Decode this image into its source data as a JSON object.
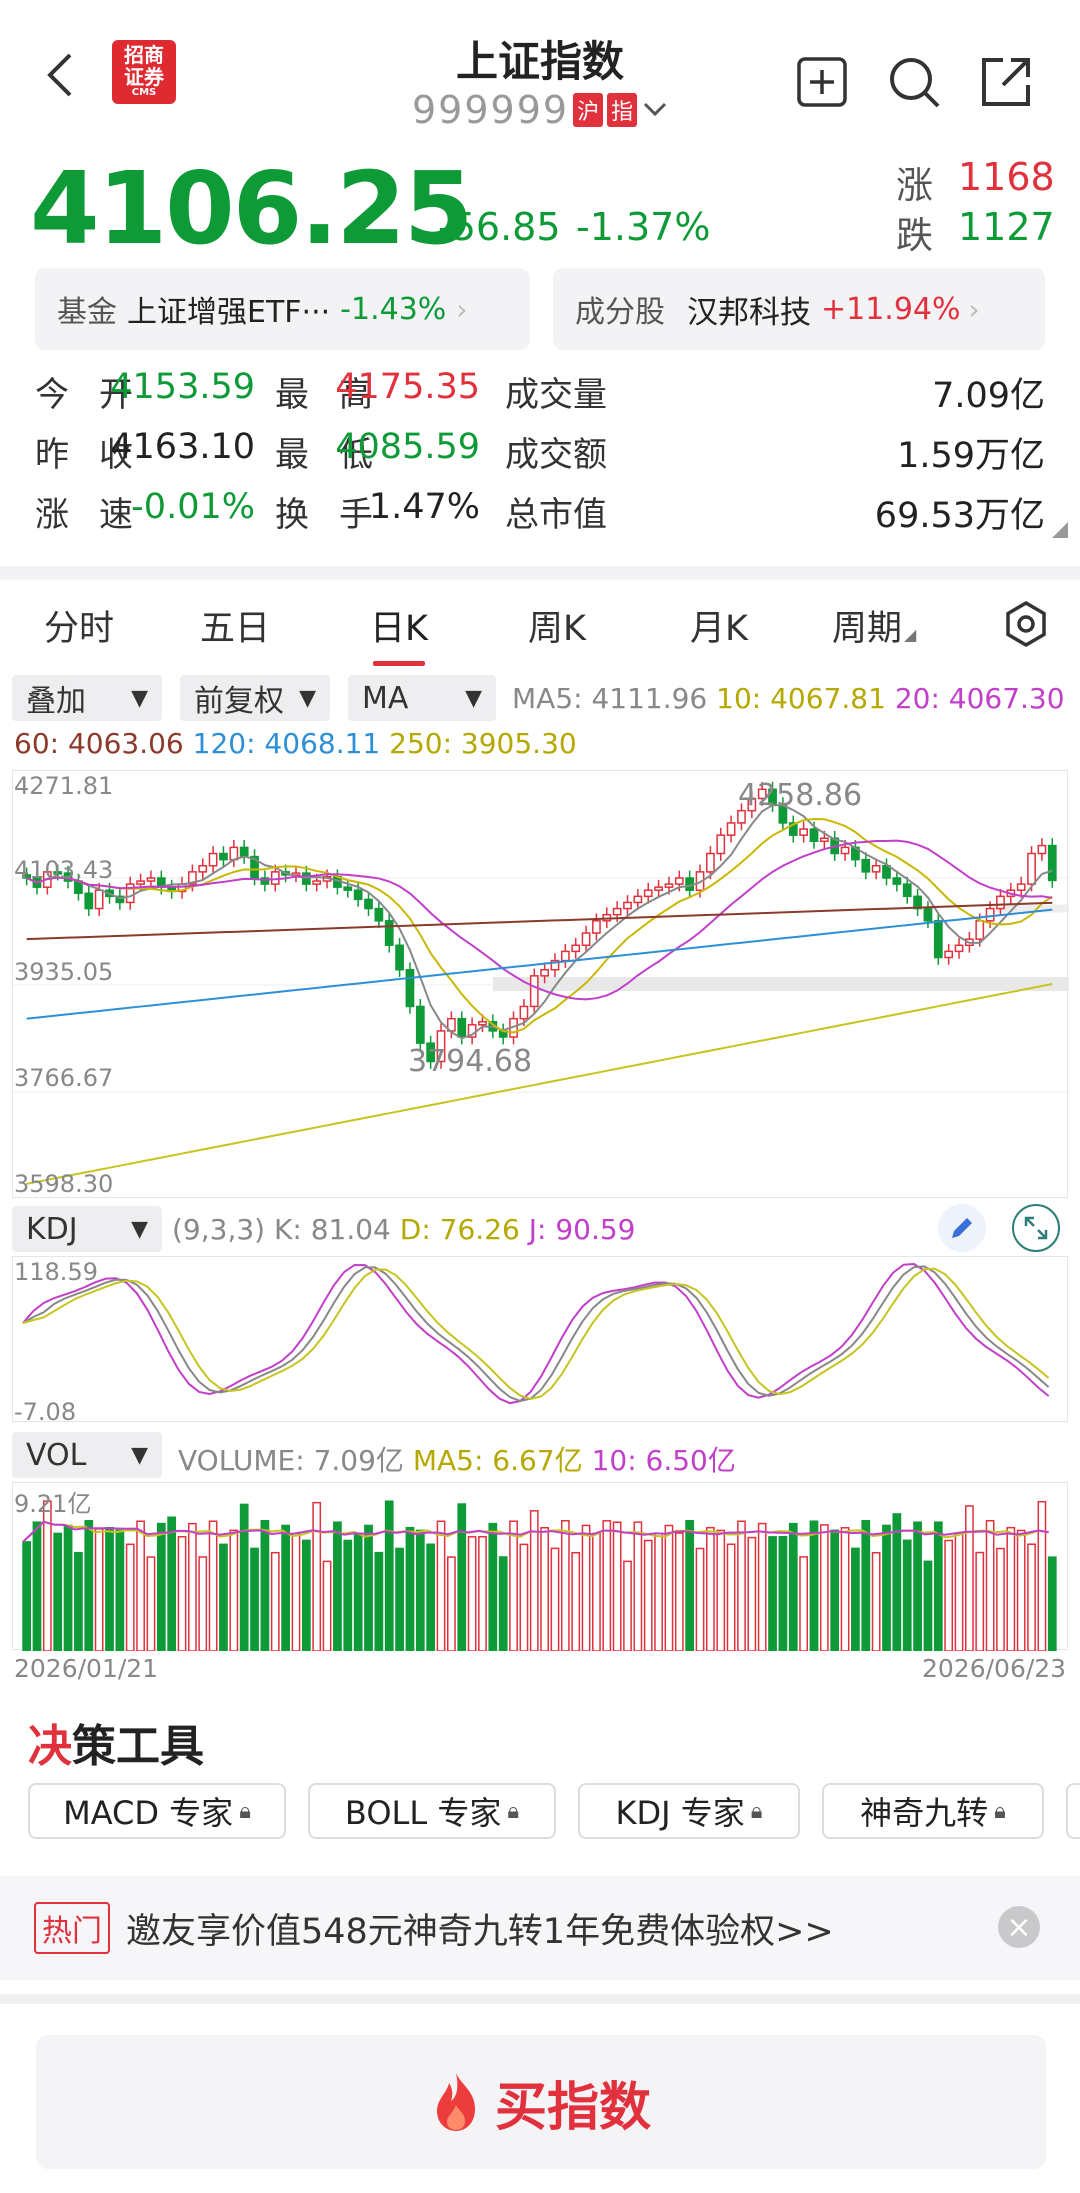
{
  "header": {
    "title": "上证指数",
    "code": "999999",
    "badge_hu": "沪",
    "badge_zhi": "指",
    "logo_text": "招商证券",
    "logo_sub": "CMS"
  },
  "quote": {
    "price": "4106.25",
    "change": "-56.85",
    "change_pct": "-1.37%",
    "up_label": "涨",
    "up_count": "1168",
    "down_label": "跌",
    "down_count": "1127"
  },
  "related": {
    "fund_label": "基金",
    "fund_name": "上证增强ETF···",
    "fund_pct": "-1.43%",
    "comp_label": "成分股",
    "comp_name": "汉邦科技",
    "comp_pct": "+11.94%"
  },
  "stats": [
    {
      "l1": "今",
      "l2": "开",
      "v": "4153.59",
      "c": "green"
    },
    {
      "l1": "最",
      "l2": "高",
      "v": "4175.35",
      "c": "red"
    },
    {
      "l": "成交量",
      "v": "7.09亿",
      "c": "dark"
    },
    {
      "l1": "昨",
      "l2": "收",
      "v": "4163.10",
      "c": "dark"
    },
    {
      "l1": "最",
      "l2": "低",
      "v": "4085.59",
      "c": "green"
    },
    {
      "l": "成交额",
      "v": "1.59万亿",
      "c": "dark"
    },
    {
      "l1": "涨",
      "l2": "速",
      "v": "-0.01%",
      "c": "green"
    },
    {
      "l1": "换",
      "l2": "手",
      "v": "1.47%",
      "c": "dark"
    },
    {
      "l": "总市值",
      "v": "69.53万亿",
      "c": "dark"
    }
  ],
  "tabs": [
    "分时",
    "五日",
    "日K",
    "周K",
    "月K",
    "周期"
  ],
  "controls": {
    "overlay": "叠加",
    "adjust": "前复权",
    "indicator": "MA"
  },
  "ma_line1": {
    "ma5": "MA5: 4111.96",
    "ma10": "10: 4067.81",
    "ma20": "20: 4067.30"
  },
  "ma_line2": {
    "ma60": "60: 4063.06",
    "ma120": "120: 4068.11",
    "ma250": "250: 3905.30"
  },
  "price_axis": [
    "4271.81",
    "4103.43",
    "3935.05",
    "3766.67",
    "3598.30"
  ],
  "chart_notes": {
    "high": "4258.86",
    "low": "3794.68"
  },
  "kdj": {
    "name": "KDJ",
    "params": "(9,3,3)",
    "k": "K: 81.04",
    "d": "D: 76.26",
    "j": "J: 90.59",
    "axis_top": "118.59",
    "axis_bottom": "-7.08"
  },
  "vol": {
    "name": "VOL",
    "volume": "VOLUME: 7.09亿",
    "ma5": "MA5: 6.67亿",
    "ma10": "10: 6.50亿",
    "axis_top": "9.21亿"
  },
  "dates": {
    "start": "2026/01/21",
    "end": "2026/06/23"
  },
  "tools": {
    "title_a": "决",
    "title_b": "策工具",
    "items": [
      "MACD 专家",
      "BOLL 专家",
      "KDJ 专家",
      "神奇九转"
    ]
  },
  "promo": {
    "tag": "热门",
    "text": "邀友享价值548元神奇九转1年免费体验权>>"
  },
  "buy_button": "买指数",
  "colors": {
    "red": "#e0313d",
    "green": "#0f9a38",
    "ma5": "#888888",
    "ma10": "#c9b800",
    "ma20": "#c23fc9",
    "ma60": "#8b3a2b",
    "ma120": "#2d8fd6",
    "ma250": "#c6c41f"
  }
}
